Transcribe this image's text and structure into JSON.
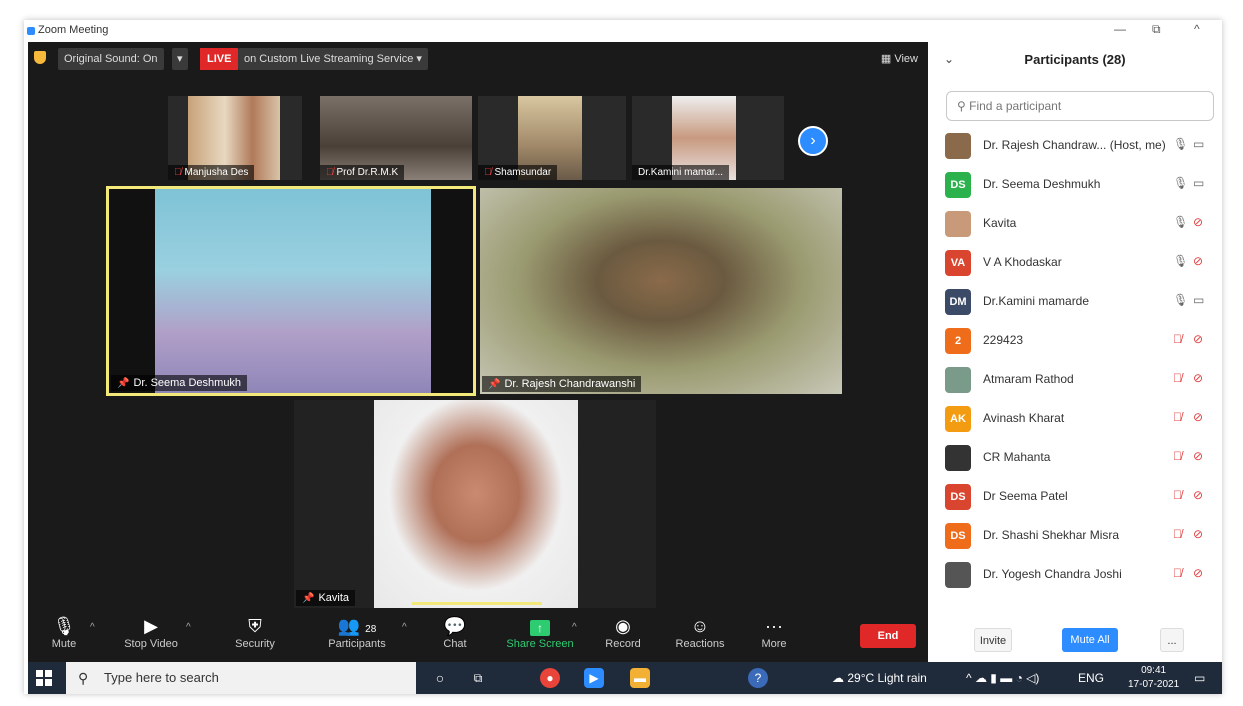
{
  "window": {
    "title": "Zoom Meeting",
    "minimize": "—",
    "maximize": "⧉",
    "close": "^"
  },
  "topbar": {
    "original_sound": "Original Sound: On",
    "dropdown": "▾",
    "live": "LIVE",
    "stream": "on Custom Live Streaming Service",
    "view": "View"
  },
  "thumbnails": [
    {
      "name": "Manjusha Des",
      "muted": true
    },
    {
      "name": "Prof Dr.R.M.K",
      "muted": true
    },
    {
      "name": "Shamsundar",
      "muted": true
    },
    {
      "name": "Dr.Kamini mamar...",
      "muted": false
    }
  ],
  "tiles": [
    {
      "name": "Dr. Seema Deshmukh"
    },
    {
      "name": "Dr. Rajesh Chandrawanshi"
    },
    {
      "name": "Kavita"
    }
  ],
  "toolbar": {
    "mute": "Mute",
    "stop_video": "Stop Video",
    "security": "Security",
    "participants": "Participants",
    "participants_count": "28",
    "chat": "Chat",
    "share_screen": "Share Screen",
    "record": "Record",
    "reactions": "Reactions",
    "more": "More",
    "end": "End"
  },
  "panel": {
    "title": "Participants (28)",
    "search_placeholder": "Find a participant",
    "invite": "Invite",
    "mute_all": "Mute All",
    "more": "...",
    "participants": [
      {
        "name": "Dr. Rajesh Chandraw... (Host, me)",
        "initials": "",
        "color": "#8a6a4a",
        "mic_off": false,
        "cam_off": false
      },
      {
        "name": "Dr. Seema Deshmukh",
        "initials": "DS",
        "color": "#2bb24c",
        "mic_off": false,
        "cam_off": false
      },
      {
        "name": "Kavita",
        "initials": "",
        "color": "#c99a7a",
        "mic_off": false,
        "cam_off": true
      },
      {
        "name": "V A Khodaskar",
        "initials": "VA",
        "color": "#d9452f",
        "mic_off": false,
        "cam_off": true
      },
      {
        "name": "Dr.Kamini mamarde",
        "initials": "DM",
        "color": "#3b4a66",
        "mic_off": false,
        "cam_off": false
      },
      {
        "name": "229423",
        "initials": "2",
        "color": "#ef6c1a",
        "mic_off": true,
        "cam_off": true
      },
      {
        "name": "Atmaram Rathod",
        "initials": "",
        "color": "#7a9a8a",
        "mic_off": true,
        "cam_off": true
      },
      {
        "name": "Avinash Kharat",
        "initials": "AK",
        "color": "#f39c12",
        "mic_off": true,
        "cam_off": true
      },
      {
        "name": "CR Mahanta",
        "initials": "",
        "color": "#333333",
        "mic_off": true,
        "cam_off": true
      },
      {
        "name": "Dr Seema Patel",
        "initials": "DS",
        "color": "#d9452f",
        "mic_off": true,
        "cam_off": true
      },
      {
        "name": "Dr. Shashi Shekhar Misra",
        "initials": "DS",
        "color": "#ef6c1a",
        "mic_off": true,
        "cam_off": true
      },
      {
        "name": "Dr. Yogesh Chandra Joshi",
        "initials": "",
        "color": "#555555",
        "mic_off": true,
        "cam_off": true
      }
    ]
  },
  "taskbar": {
    "search": "Type here to search",
    "weather": "29°C  Light rain",
    "lang": "ENG",
    "time": "09:41",
    "date": "17-07-2021"
  }
}
